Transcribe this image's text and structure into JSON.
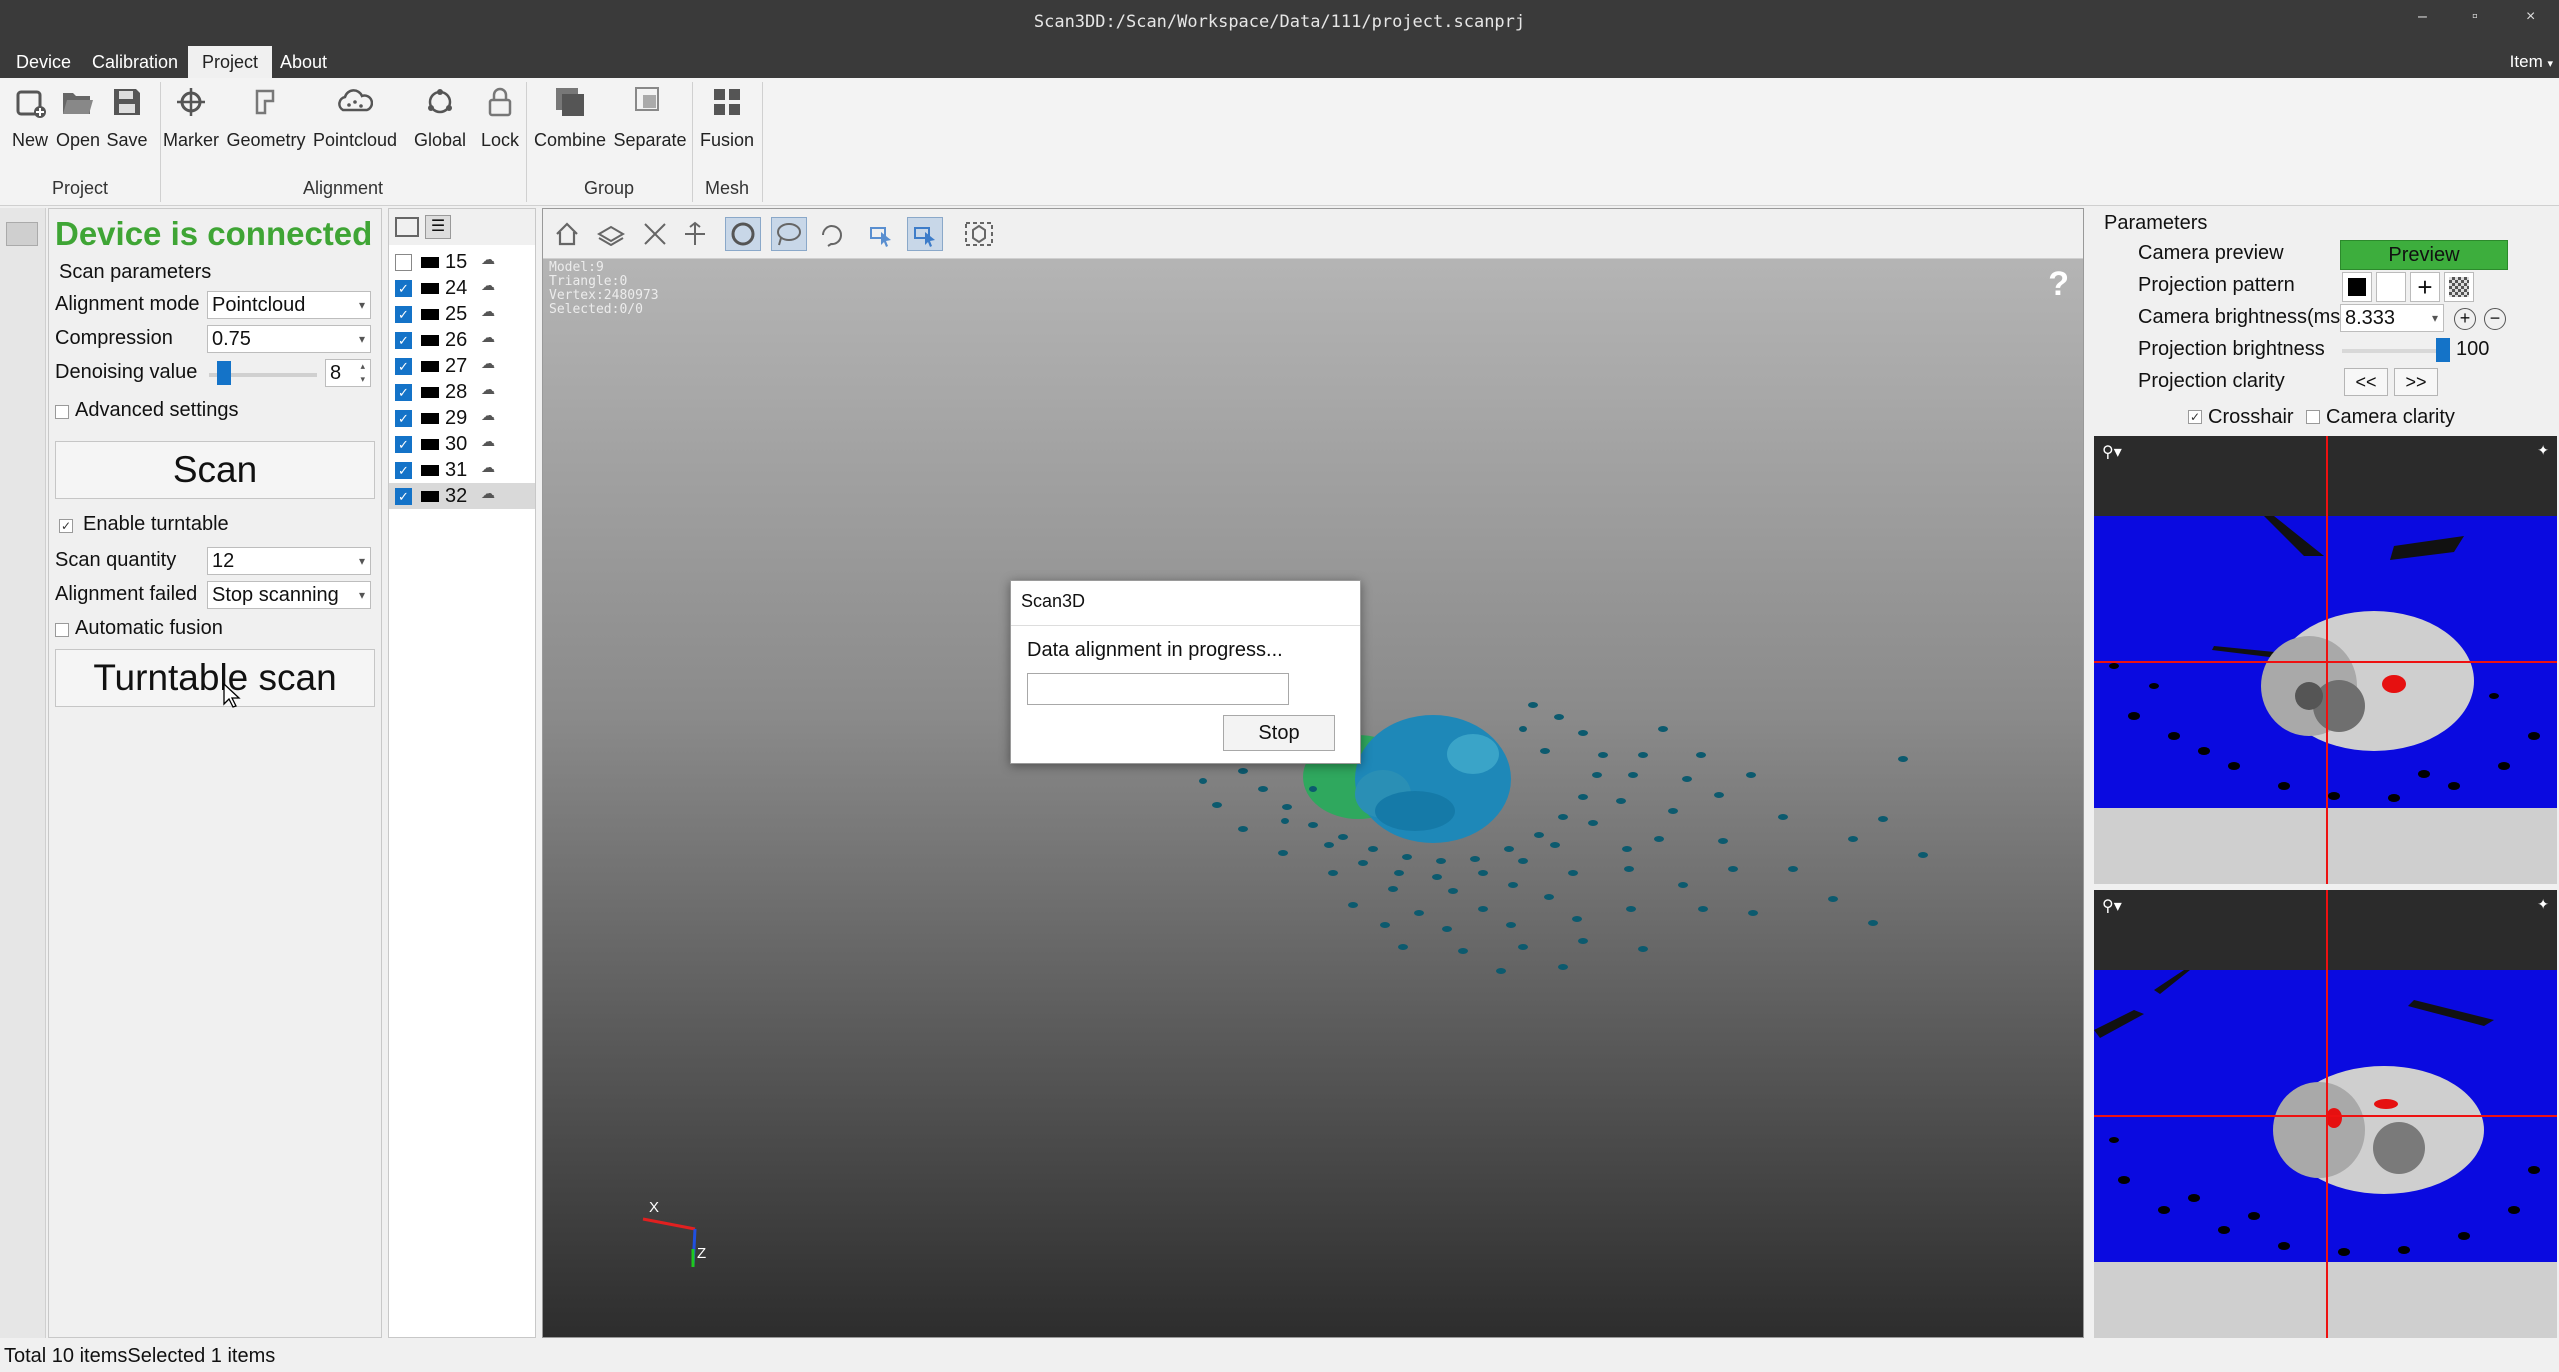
{
  "window": {
    "title": "Scan3DD:/Scan/Workspace/Data/111/project.scanprj",
    "min": "–",
    "max": "▫",
    "close": "×"
  },
  "menu": {
    "items": [
      "Device",
      "Calibration",
      "Project",
      "About"
    ],
    "right": "Item"
  },
  "ribbon": {
    "buttons": [
      "New",
      "Open",
      "Save",
      "Marker",
      "Geometry",
      "Pointcloud",
      "Global",
      "Lock",
      "Combine",
      "Separate",
      "Fusion"
    ],
    "groups": [
      "Project",
      "Alignment",
      "Group",
      "Mesh"
    ]
  },
  "scan_panel": {
    "status": "Device is connected",
    "section_title": "Scan parameters",
    "alignment_mode_label": "Alignment mode",
    "alignment_mode_value": "Pointcloud",
    "compression_label": "Compression",
    "compression_value": "0.75",
    "denoising_label": "Denoising value",
    "denoising_value": "8",
    "advanced_label": "Advanced settings",
    "scan_button": "Scan",
    "turntable_label": "Enable turntable",
    "scan_quantity_label": "Scan quantity",
    "scan_quantity_value": "12",
    "alignment_failed_label": "Alignment failed",
    "alignment_failed_value": "Stop scanning",
    "auto_fusion_label": "Automatic fusion",
    "turntable_scan_button": "Turntable scan"
  },
  "model_list": [
    {
      "id": "15",
      "checked": false
    },
    {
      "id": "24",
      "checked": true
    },
    {
      "id": "25",
      "checked": true
    },
    {
      "id": "26",
      "checked": true
    },
    {
      "id": "27",
      "checked": true
    },
    {
      "id": "28",
      "checked": true
    },
    {
      "id": "29",
      "checked": true
    },
    {
      "id": "30",
      "checked": true
    },
    {
      "id": "31",
      "checked": true
    },
    {
      "id": "32",
      "checked": true,
      "selected": true
    }
  ],
  "viewport": {
    "info": [
      "Model:9",
      "Triangle:0",
      "Vertex:2480973",
      "Selected:0/0"
    ],
    "help": "?",
    "axis_x": "X",
    "axis_z": "Z"
  },
  "dialog": {
    "title": "Scan3D",
    "message": "Data alignment in progress...",
    "stop_button": "Stop"
  },
  "parameters": {
    "title": "Parameters",
    "camera_preview_label": "Camera preview",
    "preview_button": "Preview",
    "projection_pattern_label": "Projection pattern",
    "camera_brightness_label": "Camera brightness(ms)",
    "camera_brightness_value": "8.333",
    "projection_brightness_label": "Projection brightness",
    "projection_brightness_value": "100",
    "projection_clarity_label": "Projection clarity",
    "prev_button": "<<",
    "next_button": ">>",
    "crosshair_label": "Crosshair",
    "camera_clarity_label": "Camera clarity"
  },
  "status_bar": "Total 10 itemsSelected 1 items",
  "colors": {
    "connected": "#3fa535",
    "preview": "#3dae3d",
    "camera_bg": "#0a0ae0",
    "crosshair": "#ee1111",
    "check": "#1473c8"
  }
}
